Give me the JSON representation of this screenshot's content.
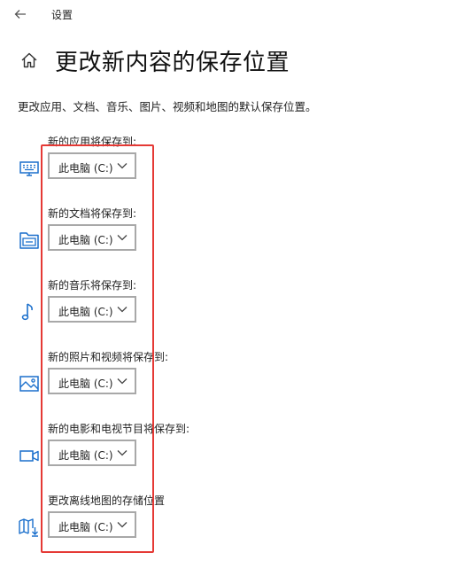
{
  "window": {
    "title": "设置"
  },
  "page": {
    "title": "更改新内容的保存位置",
    "description": "更改应用、文档、音乐、图片、视频和地图的默认保存位置。"
  },
  "settings": [
    {
      "label": "新的应用将保存到:",
      "value": "此电脑 (C:)",
      "icon": "monitor-icon"
    },
    {
      "label": "新的文档将保存到:",
      "value": "此电脑 (C:)",
      "icon": "folder-icon"
    },
    {
      "label": "新的音乐将保存到:",
      "value": "此电脑 (C:)",
      "icon": "music-note-icon"
    },
    {
      "label": "新的照片和视频将保存到:",
      "value": "此电脑 (C:)",
      "icon": "photo-icon"
    },
    {
      "label": "新的电影和电视节目将保存到:",
      "value": "此电脑 (C:)",
      "icon": "video-camera-icon"
    },
    {
      "label": "更改离线地图的存储位置",
      "value": "此电脑 (C:)",
      "icon": "map-download-icon"
    }
  ],
  "colors": {
    "accent": "#1a6fcc",
    "highlight": "#e53935"
  }
}
